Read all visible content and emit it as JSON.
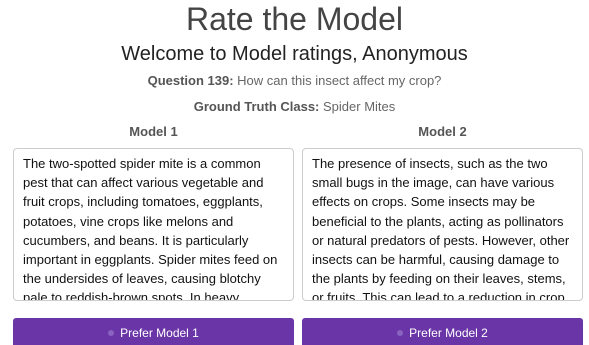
{
  "header": {
    "title": "Rate the Model",
    "welcome": "Welcome to Model ratings, Anonymous"
  },
  "question": {
    "label": "Question 139:",
    "text": "How can this insect affect my crop?"
  },
  "ground_truth": {
    "label": "Ground Truth Class:",
    "value": "Spider Mites"
  },
  "models": [
    {
      "label": "Model 1",
      "answer": "The two-spotted spider mite is a common pest that can affect various vegetable and fruit crops, including tomatoes, eggplants, potatoes, vine crops like melons and cucumbers, and beans. It is particularly important in eggplants. Spider mites feed on the undersides of leaves, causing blotchy pale to reddish-brown spots. In heavy infestations, they move to the tops of leaves and",
      "prefer_label": "Prefer Model 1"
    },
    {
      "label": "Model 2",
      "answer": "The presence of insects, such as the two small bugs in the image, can have various effects on crops. Some insects may be beneficial to the plants, acting as pollinators or natural predators of pests. However, other insects can be harmful, causing damage to the plants by feeding on their leaves, stems, or fruits. This can lead to a reduction in crop yield, as well as potential",
      "prefer_label": "Prefer Model 2"
    }
  ],
  "colors": {
    "button_bg": "#6a35a6",
    "button_text": "#ffffff"
  }
}
